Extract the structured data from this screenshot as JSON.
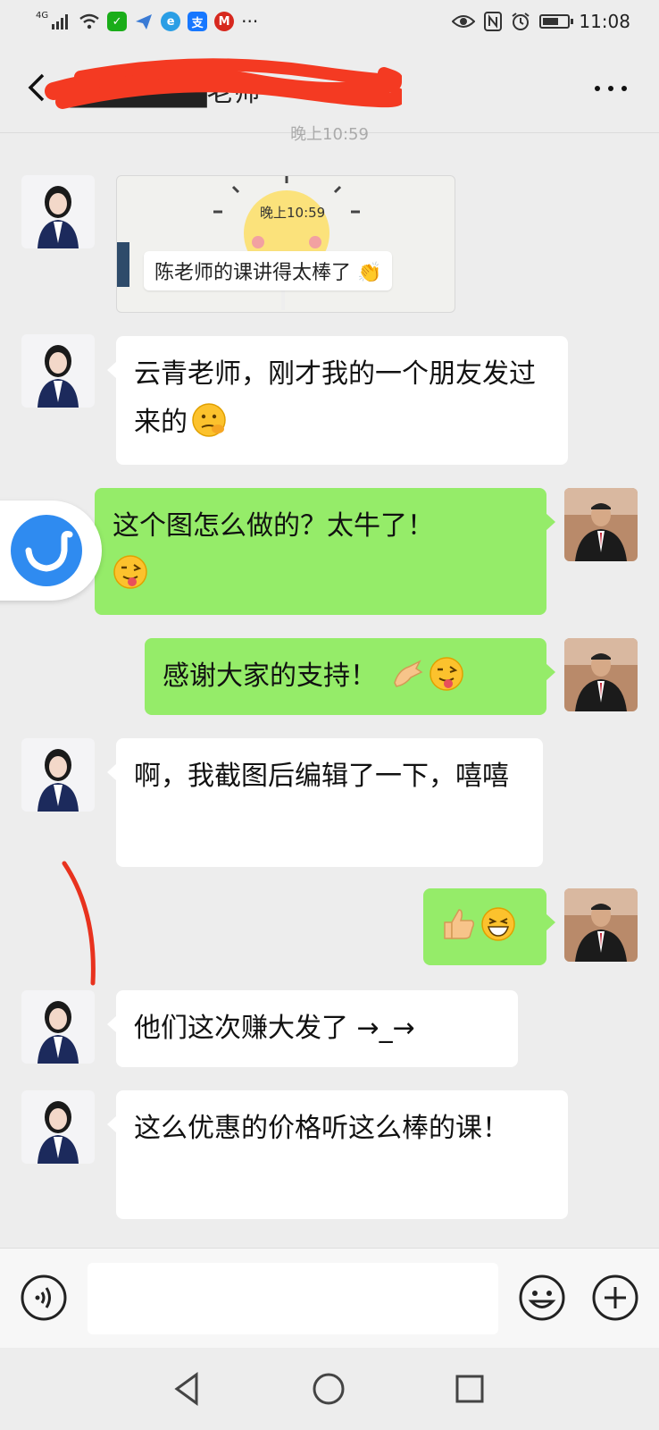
{
  "status_bar": {
    "network": "4G",
    "time": "11:08",
    "app_icon_text": "支"
  },
  "header": {
    "title": "▇▇▇▇▇▇▇老师",
    "timestamp": "晚上10:59"
  },
  "image_message": {
    "time_text": "晚上10:59",
    "caption": "陈老师的课讲得太棒了"
  },
  "messages": [
    {
      "side": "in",
      "text": "云青老师，刚才我的一个朋友发过来的",
      "emoji": "thinking-face"
    },
    {
      "side": "out",
      "text": "这个图怎么做的？太牛了！",
      "emoji": "winking-face-tongue"
    },
    {
      "side": "out",
      "text": "感谢大家的支持！",
      "emoji": "ok-hand-wink"
    },
    {
      "side": "in",
      "text": "啊，我截图后编辑了一下，嘻嘻",
      "emoji": ""
    },
    {
      "side": "out",
      "text": "",
      "emoji": "thumbs-up-grin"
    },
    {
      "side": "in",
      "text": "他们这次赚大发了 →_→",
      "emoji": ""
    },
    {
      "side": "in",
      "text": "这么优惠的价格听这么棒的课！",
      "emoji": ""
    }
  ],
  "input": {
    "placeholder": ""
  },
  "colors": {
    "background": "#ededed",
    "incoming_bubble": "#ffffff",
    "outgoing_bubble": "#95ec69",
    "floating_button": "#2f8bf0",
    "annotation_red": "#e8321e"
  }
}
